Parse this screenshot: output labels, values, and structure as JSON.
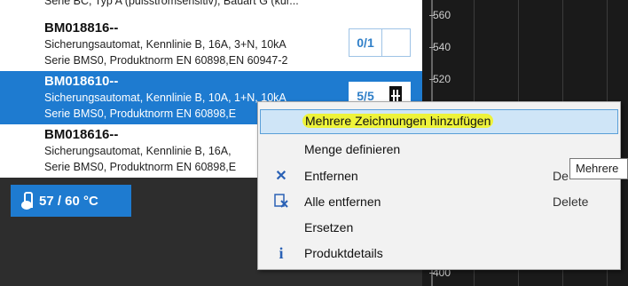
{
  "products": {
    "top_partial": "Serie BC, Typ A (pulsstromsensitiv), Bauart G (kur...",
    "rows": [
      {
        "code": "BM018816--",
        "desc": "Sicherungsautomat, Kennlinie B, 16A, 3+N, 10kA",
        "serie": "Serie BMS0, Produktnorm EN 60898,EN 60947-2",
        "qty": "0/1"
      },
      {
        "code": "BM018610--",
        "desc": "Sicherungsautomat, Kennlinie B, 10A, 1+N, 10kA",
        "serie": "Serie BMS0, Produktnorm EN 60898,E",
        "qty": "5/5"
      },
      {
        "code": "BM018616--",
        "desc": "Sicherungsautomat, Kennlinie B, 16A,",
        "serie": "Serie BMS0, Produktnorm EN 60898,E"
      }
    ]
  },
  "temperature": {
    "value": "57 / 60 °C"
  },
  "chart": {
    "ticks": [
      "560",
      "540",
      "520",
      "400"
    ]
  },
  "context_menu": {
    "items": [
      {
        "label": "Mehrere Zeichnungen hinzufügen",
        "icon": "",
        "shortcut": ""
      },
      {
        "label": "Menge definieren",
        "icon": "",
        "shortcut": ""
      },
      {
        "label": "Entfernen",
        "icon": "close-icon",
        "shortcut": "De"
      },
      {
        "label": "Alle entfernen",
        "icon": "remove-all-icon",
        "shortcut": "Delete"
      },
      {
        "label": "Ersetzen",
        "icon": "",
        "shortcut": ""
      },
      {
        "label": "Produktdetails",
        "icon": "info-icon",
        "shortcut": ""
      }
    ]
  },
  "tooltip": {
    "text": "Mehrere"
  },
  "colors": {
    "accent": "#1e7bd0",
    "highlight": "#eef33a",
    "menu_hover": "#cfe5f7"
  }
}
